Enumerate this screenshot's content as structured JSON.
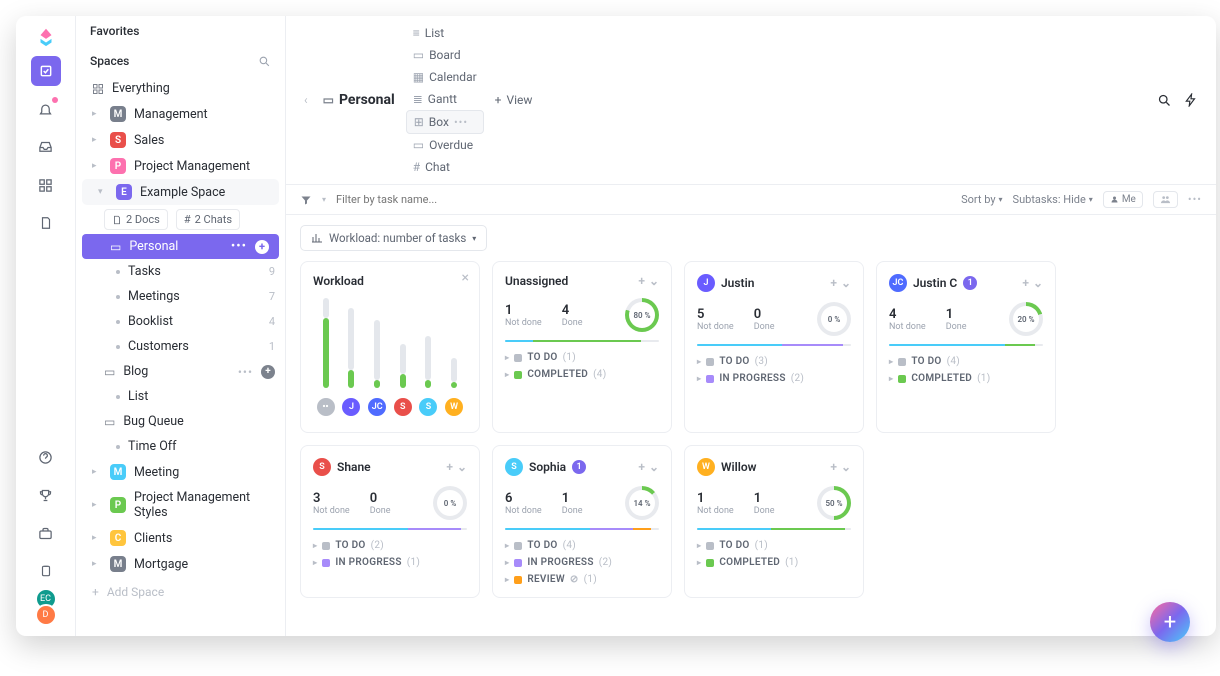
{
  "sidebar": {
    "favorites_label": "Favorites",
    "spaces_label": "Spaces",
    "everything": "Everything",
    "spaces": [
      {
        "letter": "M",
        "color": "#787f8c",
        "label": "Management"
      },
      {
        "letter": "S",
        "color": "#e94f4a",
        "label": "Sales"
      },
      {
        "letter": "P",
        "color": "#fd71af",
        "label": "Project Management"
      },
      {
        "letter": "E",
        "color": "#7b68ee",
        "label": "Example Space"
      }
    ],
    "docs_chip": "2 Docs",
    "chats_chip": "2 Chats",
    "personal": {
      "label": "Personal",
      "items": [
        {
          "label": "Tasks",
          "count": "9"
        },
        {
          "label": "Meetings",
          "count": "7"
        },
        {
          "label": "Booklist",
          "count": "4"
        },
        {
          "label": "Customers",
          "count": "1"
        }
      ]
    },
    "blog": {
      "label": "Blog",
      "sub": "List"
    },
    "bug_queue": "Bug Queue",
    "time_off": "Time Off",
    "bottom_spaces": [
      {
        "letter": "M",
        "color": "#49ccf9",
        "label": "Meeting"
      },
      {
        "letter": "P",
        "color": "#6bc950",
        "label": "Project Management Styles"
      },
      {
        "letter": "C",
        "color": "#ffc53d",
        "label": "Clients"
      },
      {
        "letter": "M",
        "color": "#787f8c",
        "label": "Mortgage"
      }
    ],
    "add_space": "Add Space"
  },
  "topbar": {
    "title": "Personal",
    "views": [
      {
        "key": "list",
        "label": "List"
      },
      {
        "key": "board",
        "label": "Board"
      },
      {
        "key": "calendar",
        "label": "Calendar"
      },
      {
        "key": "gantt",
        "label": "Gantt"
      },
      {
        "key": "box",
        "label": "Box",
        "active": true
      },
      {
        "key": "overdue",
        "label": "Overdue"
      },
      {
        "key": "chat",
        "label": "Chat"
      }
    ],
    "add_view": "View"
  },
  "toolbar": {
    "filter_placeholder": "Filter by task name...",
    "sort_by": "Sort by",
    "subtasks": "Subtasks: Hide",
    "me": "Me",
    "workload_label": "Workload: number of tasks"
  },
  "workload_card": {
    "title": "Workload",
    "bars": [
      {
        "green": 70,
        "gray": 20
      },
      {
        "green": 18,
        "gray": 62
      },
      {
        "green": 8,
        "gray": 60
      },
      {
        "green": 14,
        "gray": 30
      },
      {
        "green": 8,
        "gray": 44
      },
      {
        "green": 6,
        "gray": 24
      }
    ],
    "avatars": [
      {
        "letter": "",
        "color": "#b9bec7",
        "icon": true
      },
      {
        "letter": "J",
        "color": "#6a5cff"
      },
      {
        "letter": "JC",
        "color": "#4f6bff"
      },
      {
        "letter": "S",
        "color": "#e94f4a"
      },
      {
        "letter": "S",
        "color": "#49ccf9"
      },
      {
        "letter": "W",
        "color": "#ffb020"
      }
    ]
  },
  "people": [
    {
      "name": "Unassigned",
      "avatar": null,
      "not_done": "1",
      "done": "4",
      "pct": "80 %",
      "pct_deg": 288,
      "ring_color": "#6bc950",
      "segs": [
        {
          "c": "#49ccf9",
          "w": 18
        },
        {
          "c": "#6bc950",
          "w": 70
        }
      ],
      "statuses": [
        {
          "label": "TO DO",
          "color": "#b9bec7",
          "count": "(1)"
        },
        {
          "label": "COMPLETED",
          "color": "#6bc950",
          "count": "(4)"
        }
      ]
    },
    {
      "name": "Justin",
      "avatar": {
        "letter": "J",
        "color": "#6a5cff"
      },
      "not_done": "5",
      "done": "0",
      "pct": "0 %",
      "pct_deg": 0,
      "ring_color": "#6bc950",
      "segs": [
        {
          "c": "#49ccf9",
          "w": 55
        },
        {
          "c": "#a78bfa",
          "w": 40
        }
      ],
      "statuses": [
        {
          "label": "TO DO",
          "color": "#b9bec7",
          "count": "(3)"
        },
        {
          "label": "IN PROGRESS",
          "color": "#a78bfa",
          "count": "(2)"
        }
      ]
    },
    {
      "name": "Justin C",
      "avatar": {
        "letter": "JC",
        "color": "#4f6bff"
      },
      "badge": "1",
      "not_done": "4",
      "done": "1",
      "pct": "20 %",
      "pct_deg": 72,
      "ring_color": "#6bc950",
      "segs": [
        {
          "c": "#49ccf9",
          "w": 75
        },
        {
          "c": "#6bc950",
          "w": 20
        }
      ],
      "statuses": [
        {
          "label": "TO DO",
          "color": "#b9bec7",
          "count": "(4)"
        },
        {
          "label": "COMPLETED",
          "color": "#6bc950",
          "count": "(1)"
        }
      ]
    },
    {
      "name": "Shane",
      "avatar": {
        "letter": "S",
        "color": "#e94f4a"
      },
      "not_done": "3",
      "done": "0",
      "pct": "0 %",
      "pct_deg": 0,
      "ring_color": "#6bc950",
      "segs": [
        {
          "c": "#49ccf9",
          "w": 62
        },
        {
          "c": "#a78bfa",
          "w": 34
        }
      ],
      "statuses": [
        {
          "label": "TO DO",
          "color": "#b9bec7",
          "count": "(2)"
        },
        {
          "label": "IN PROGRESS",
          "color": "#a78bfa",
          "count": "(1)"
        }
      ]
    },
    {
      "name": "Sophia",
      "avatar": {
        "letter": "S",
        "color": "#49ccf9"
      },
      "badge": "1",
      "not_done": "6",
      "done": "1",
      "pct": "14 %",
      "pct_deg": 50,
      "ring_color": "#6bc950",
      "segs": [
        {
          "c": "#49ccf9",
          "w": 55
        },
        {
          "c": "#a78bfa",
          "w": 28
        },
        {
          "c": "#ff9f1a",
          "w": 12
        }
      ],
      "statuses": [
        {
          "label": "TO DO",
          "color": "#b9bec7",
          "count": "(4)"
        },
        {
          "label": "IN PROGRESS",
          "color": "#a78bfa",
          "count": "(2)"
        },
        {
          "label": "REVIEW",
          "color": "#ff9f1a",
          "count": "(1)",
          "check": true
        }
      ]
    },
    {
      "name": "Willow",
      "avatar": {
        "letter": "W",
        "color": "#ffb020"
      },
      "not_done": "1",
      "done": "1",
      "pct": "50 %",
      "pct_deg": 180,
      "ring_color": "#6bc950",
      "segs": [
        {
          "c": "#49ccf9",
          "w": 48
        },
        {
          "c": "#6bc950",
          "w": 48
        }
      ],
      "statuses": [
        {
          "label": "TO DO",
          "color": "#b9bec7",
          "count": "(1)"
        },
        {
          "label": "COMPLETED",
          "color": "#6bc950",
          "count": "(1)"
        }
      ]
    }
  ],
  "labels": {
    "not_done": "Not done",
    "done": "Done"
  }
}
